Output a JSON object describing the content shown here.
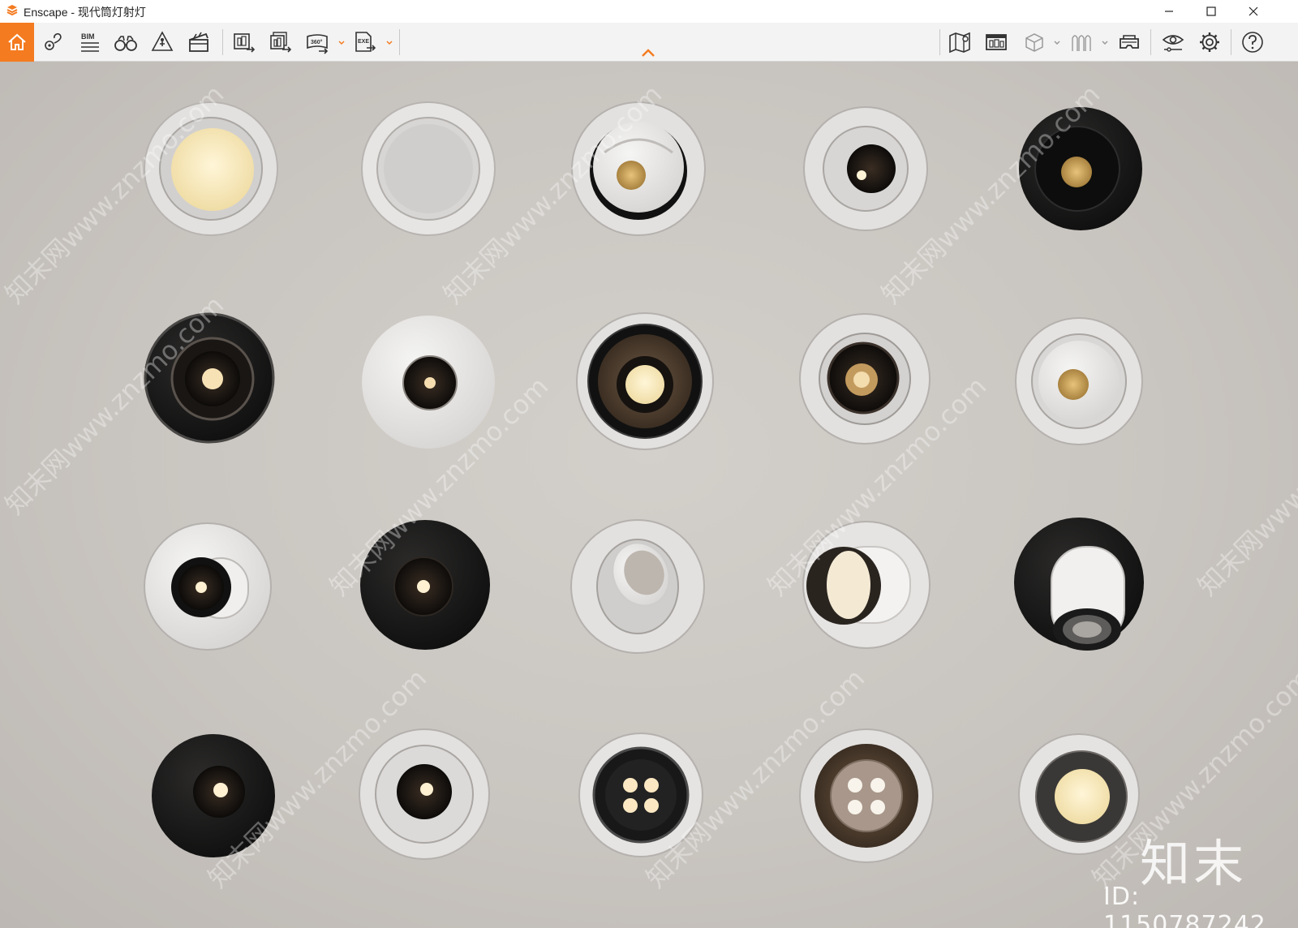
{
  "window": {
    "title": "Enscape - 现代筒灯射灯",
    "controls": [
      "minimize-icon",
      "maximize-icon",
      "close-icon"
    ]
  },
  "toolbar": {
    "left_tools": [
      "home-icon",
      "location-pin-icon",
      "bim-icon",
      "binoculars-icon",
      "walk-mode-icon",
      "clapperboard-icon",
      "render-screenshot-icon",
      "batch-render-icon",
      "panorama-360-icon",
      "export-exe-icon"
    ],
    "bim_label": "BIM",
    "panorama_label": "360°",
    "exe_label": "EXE",
    "right_tools": [
      "map-view-icon",
      "asset-library-icon",
      "cube-icon",
      "sections-icon",
      "vr-headset-icon",
      "visual-settings-icon",
      "settings-gear-icon",
      "help-icon"
    ],
    "accent_color": "#f47b20"
  },
  "viewport": {
    "watermark_logo": "知末",
    "watermark_id": "ID: 1150787242",
    "watermark_url": "知末网www.znzmo.com",
    "background_color": "#c9c5c0"
  }
}
